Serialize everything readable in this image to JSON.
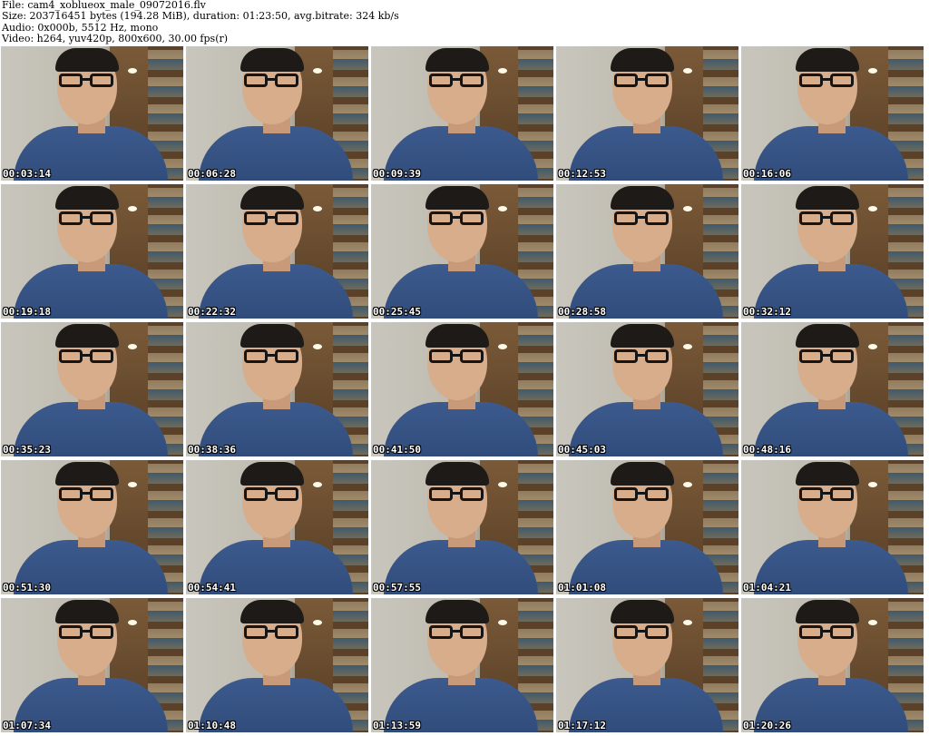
{
  "header": {
    "file_line": "File: cam4_xoblueox_male_09072016.flv",
    "size_line": "Size: 203716451 bytes (194.28 MiB), duration: 01:23:50, avg.bitrate: 324 kb/s",
    "audio_line": "Audio: 0x000b, 5512 Hz, mono",
    "video_line": "Video: h264, yuv420p, 800x600, 30.00 fps(r)"
  },
  "thumbnails": [
    {
      "timestamp": "00:03:14"
    },
    {
      "timestamp": "00:06:28"
    },
    {
      "timestamp": "00:09:39"
    },
    {
      "timestamp": "00:12:53"
    },
    {
      "timestamp": "00:16:06"
    },
    {
      "timestamp": "00:19:18"
    },
    {
      "timestamp": "00:22:32"
    },
    {
      "timestamp": "00:25:45"
    },
    {
      "timestamp": "00:28:58"
    },
    {
      "timestamp": "00:32:12"
    },
    {
      "timestamp": "00:35:23"
    },
    {
      "timestamp": "00:38:36"
    },
    {
      "timestamp": "00:41:50"
    },
    {
      "timestamp": "00:45:03"
    },
    {
      "timestamp": "00:48:16"
    },
    {
      "timestamp": "00:51:30"
    },
    {
      "timestamp": "00:54:41"
    },
    {
      "timestamp": "00:57:55"
    },
    {
      "timestamp": "01:01:08"
    },
    {
      "timestamp": "01:04:21"
    },
    {
      "timestamp": "01:07:34"
    },
    {
      "timestamp": "01:10:48"
    },
    {
      "timestamp": "01:13:59"
    },
    {
      "timestamp": "01:17:12"
    },
    {
      "timestamp": "01:20:26"
    }
  ]
}
